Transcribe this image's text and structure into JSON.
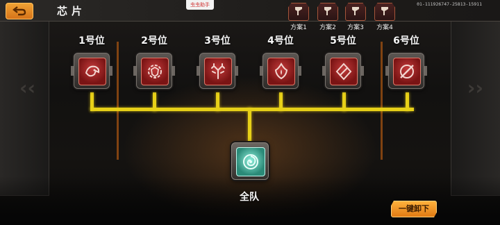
{
  "header": {
    "title": "芯片",
    "assist_badge": "虫虫助手",
    "device_id": "01-111926747-25813-15911"
  },
  "plans": [
    {
      "label": "方案1"
    },
    {
      "label": "方案2"
    },
    {
      "label": "方案3"
    },
    {
      "label": "方案4"
    }
  ],
  "slots": [
    {
      "label": "1号位",
      "icon": "wolf-emblem-icon"
    },
    {
      "label": "2号位",
      "icon": "gear-shield-icon"
    },
    {
      "label": "3号位",
      "icon": "antler-emblem-icon"
    },
    {
      "label": "4号位",
      "icon": "flame-emblem-icon"
    },
    {
      "label": "5号位",
      "icon": "diamond-emblem-icon"
    },
    {
      "label": "6号位",
      "icon": "slash-circle-icon"
    }
  ],
  "team": {
    "label": "全队",
    "icon": "swirl-chip-icon"
  },
  "actions": {
    "unload_all": "一键卸下"
  },
  "colors": {
    "accent": "#e7d018",
    "button": "#f0a234",
    "slot_red": "#c13a3a",
    "team_teal": "#2b8a78"
  }
}
